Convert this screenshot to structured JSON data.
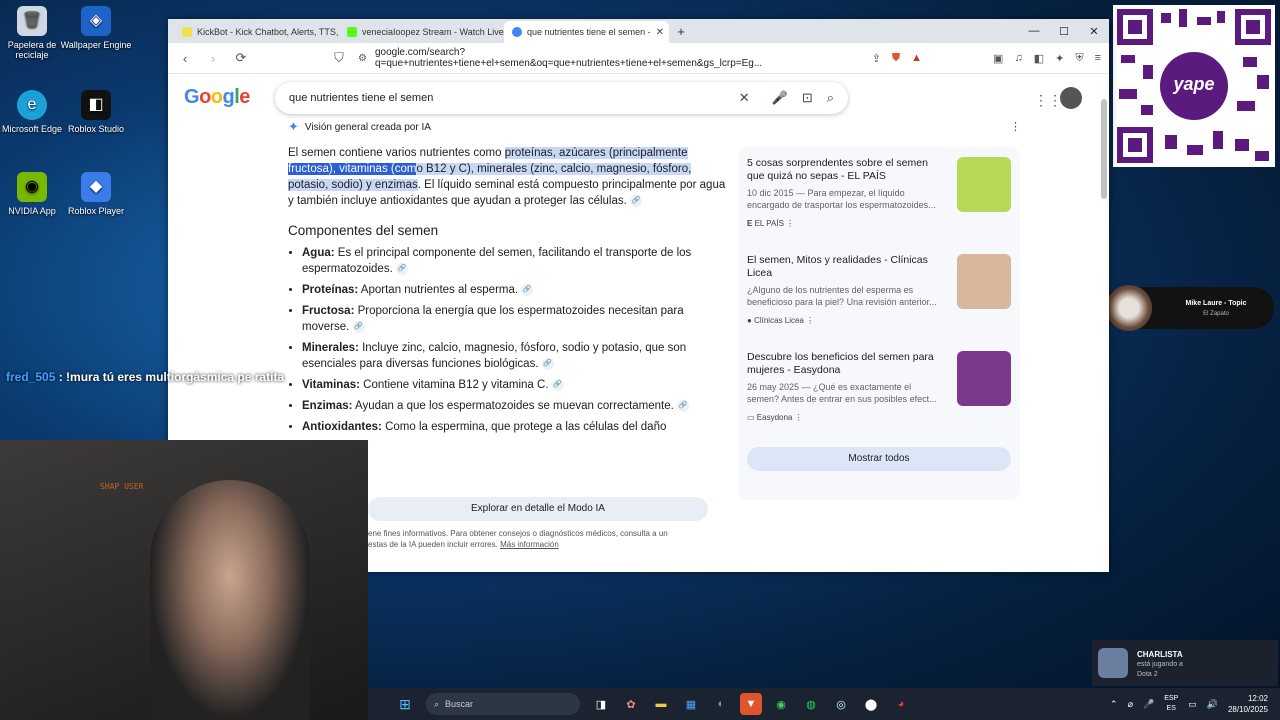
{
  "desktop": {
    "icons": [
      {
        "label": "Papelera de reciclaje",
        "icon": "recycle-bin-icon"
      },
      {
        "label": "Wallpaper Engine",
        "icon": "wallpaper-engine-icon"
      },
      {
        "label": "Microsoft Edge",
        "icon": "edge-icon"
      },
      {
        "label": "Roblox Studio",
        "icon": "roblox-studio-icon"
      },
      {
        "label": "NVIDIA App",
        "icon": "nvidia-icon"
      },
      {
        "label": "Roblox Player",
        "icon": "roblox-player-icon"
      }
    ]
  },
  "browser": {
    "tabs": [
      {
        "label": "KickBot - Kick Chatbot, Alerts, TTS, C",
        "color": "#f2e14c"
      },
      {
        "label": "veneciaIoopez Stream - Watch Live o",
        "color": "#53fc18"
      },
      {
        "label": "que nutrientes tiene el semen - ",
        "color": "#4285f4"
      }
    ],
    "new_tab": "+",
    "url": "google.com/search?q=que+nutrientes+tiene+el+semen&oq=que+nutrientes+tiene+el+semen&gs_lcrp=Eg..."
  },
  "google": {
    "logo": "Google",
    "query": "que nutrientes tiene el semen",
    "ai_header": "Visión general creada por IA",
    "intro": {
      "p1": "El semen contiene varios nutrientes como ",
      "hl1": "proteínas, azúcares (principalmente ",
      "sel": "fructosa), vitaminas (com",
      "hl2": "o B12 y C), minerales (zinc, calcio, magnesio, fósforo, potasio, sodio) y enzimas",
      "p2": ". El líquido seminal está compuesto principalmente por agua y también incluye antioxidantes que ayudan a proteger las células."
    },
    "section_title": "Componentes del semen",
    "components": [
      {
        "name": "Agua:",
        "text": " Es el principal componente del semen, facilitando el transporte de los espermatozoides."
      },
      {
        "name": "Proteínas:",
        "text": " Aportan nutrientes al esperma."
      },
      {
        "name": "Fructosa:",
        "text": " Proporciona la energía que los espermatozoides necesitan para moverse."
      },
      {
        "name": "Minerales:",
        "text": " Incluye zinc, calcio, magnesio, fósforo, sodio y potasio, que son esenciales para diversas funciones biológicas."
      },
      {
        "name": "Vitaminas:",
        "text": " Contiene vitamina B12 y vitamina C."
      },
      {
        "name": "Enzimas:",
        "text": " Ayudan a que los espermatozoides se muevan correctamente."
      },
      {
        "name": "Antioxidantes:",
        "text": " Como la espermina, que protege a las células del daño"
      }
    ],
    "sources": [
      {
        "title": "5 cosas sorprendentes sobre el semen que quizá no sepas - EL PAÍS",
        "snippet": "10 dic 2015 — Para empezar, el líquido encargado de trasportar los espermatozoides...",
        "publisher": "EL PAÍS",
        "thumb": "#b8d957"
      },
      {
        "title": "El semen, Mitos y realidades - Clínicas Licea",
        "snippet": "¿Alguno de los nutrientes del esperma es beneficioso para la piel? Una revisión anterior...",
        "publisher": "Clínicas Licea",
        "thumb": "#d8b79c"
      },
      {
        "title": "Descubre los beneficios del semen para mujeres - Easydona",
        "snippet": "26 may 2025 — ¿Qué es exactamente el semen? Antes de entrar en sus posibles efect...",
        "publisher": "Easydona",
        "thumb": "#7a3a8c"
      }
    ],
    "show_all": "Mostrar todos",
    "explore": "Explorar en detalle el Modo IA",
    "disclaimer": "ene fines informativos. Para obtener consejos o diagnósticos médicos, consulta a un",
    "disclaimer2": "estas de la IA pueden incluir errores.",
    "more_info": "Más información"
  },
  "overlay": {
    "chat_user": "fred_505",
    "chat_msg": " : !mura tú eres multiorgásmica pe ratita",
    "watermark": "SHAP USER",
    "qr_brand": "yape",
    "spotify_song": "Mike Laure - Topic",
    "spotify_sub": "El Zapato",
    "notif_user": "CHARLISTA",
    "notif_status": "está jugando a",
    "notif_game": "Dota 2"
  },
  "taskbar": {
    "search": "Buscar",
    "lang1": "ESP",
    "lang2": "ES",
    "time": "12:02",
    "date": "28/10/2025"
  }
}
